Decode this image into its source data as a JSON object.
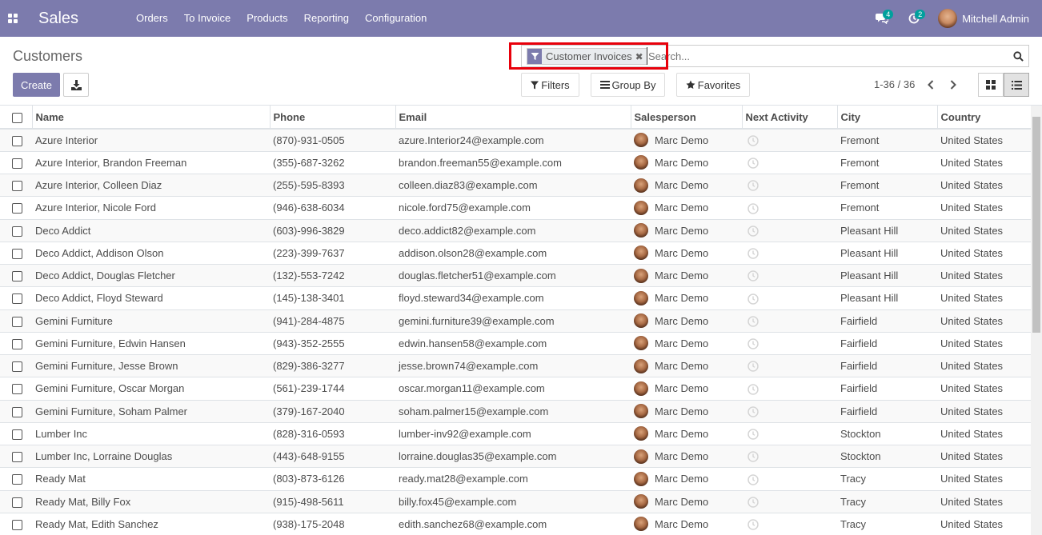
{
  "navbar": {
    "brand": "Sales",
    "menu": [
      "Orders",
      "To Invoice",
      "Products",
      "Reporting",
      "Configuration"
    ],
    "messages_count": "4",
    "activities_count": "2",
    "user_name": "Mitchell Admin"
  },
  "control_panel": {
    "title": "Customers",
    "facet_label": "Customer Invoices",
    "search_placeholder": "Search...",
    "create_label": "Create",
    "filters_label": "Filters",
    "groupby_label": "Group By",
    "favorites_label": "Favorites",
    "pager": "1-36 / 36"
  },
  "table": {
    "columns": [
      "Name",
      "Phone",
      "Email",
      "Salesperson",
      "Next Activity",
      "City",
      "Country"
    ],
    "rows": [
      {
        "name": "Azure Interior",
        "phone": "(870)-931-0505",
        "email": "azure.Interior24@example.com",
        "salesperson": "Marc Demo",
        "city": "Fremont",
        "country": "United States"
      },
      {
        "name": "Azure Interior, Brandon Freeman",
        "phone": "(355)-687-3262",
        "email": "brandon.freeman55@example.com",
        "salesperson": "Marc Demo",
        "city": "Fremont",
        "country": "United States"
      },
      {
        "name": "Azure Interior, Colleen Diaz",
        "phone": "(255)-595-8393",
        "email": "colleen.diaz83@example.com",
        "salesperson": "Marc Demo",
        "city": "Fremont",
        "country": "United States"
      },
      {
        "name": "Azure Interior, Nicole Ford",
        "phone": "(946)-638-6034",
        "email": "nicole.ford75@example.com",
        "salesperson": "Marc Demo",
        "city": "Fremont",
        "country": "United States"
      },
      {
        "name": "Deco Addict",
        "phone": "(603)-996-3829",
        "email": "deco.addict82@example.com",
        "salesperson": "Marc Demo",
        "city": "Pleasant Hill",
        "country": "United States"
      },
      {
        "name": "Deco Addict, Addison Olson",
        "phone": "(223)-399-7637",
        "email": "addison.olson28@example.com",
        "salesperson": "Marc Demo",
        "city": "Pleasant Hill",
        "country": "United States"
      },
      {
        "name": "Deco Addict, Douglas Fletcher",
        "phone": "(132)-553-7242",
        "email": "douglas.fletcher51@example.com",
        "salesperson": "Marc Demo",
        "city": "Pleasant Hill",
        "country": "United States"
      },
      {
        "name": "Deco Addict, Floyd Steward",
        "phone": "(145)-138-3401",
        "email": "floyd.steward34@example.com",
        "salesperson": "Marc Demo",
        "city": "Pleasant Hill",
        "country": "United States"
      },
      {
        "name": "Gemini Furniture",
        "phone": "(941)-284-4875",
        "email": "gemini.furniture39@example.com",
        "salesperson": "Marc Demo",
        "city": "Fairfield",
        "country": "United States"
      },
      {
        "name": "Gemini Furniture, Edwin Hansen",
        "phone": "(943)-352-2555",
        "email": "edwin.hansen58@example.com",
        "salesperson": "Marc Demo",
        "city": "Fairfield",
        "country": "United States"
      },
      {
        "name": "Gemini Furniture, Jesse Brown",
        "phone": "(829)-386-3277",
        "email": "jesse.brown74@example.com",
        "salesperson": "Marc Demo",
        "city": "Fairfield",
        "country": "United States"
      },
      {
        "name": "Gemini Furniture, Oscar Morgan",
        "phone": "(561)-239-1744",
        "email": "oscar.morgan11@example.com",
        "salesperson": "Marc Demo",
        "city": "Fairfield",
        "country": "United States"
      },
      {
        "name": "Gemini Furniture, Soham Palmer",
        "phone": "(379)-167-2040",
        "email": "soham.palmer15@example.com",
        "salesperson": "Marc Demo",
        "city": "Fairfield",
        "country": "United States"
      },
      {
        "name": "Lumber Inc",
        "phone": "(828)-316-0593",
        "email": "lumber-inv92@example.com",
        "salesperson": "Marc Demo",
        "city": "Stockton",
        "country": "United States"
      },
      {
        "name": "Lumber Inc, Lorraine Douglas",
        "phone": "(443)-648-9155",
        "email": "lorraine.douglas35@example.com",
        "salesperson": "Marc Demo",
        "city": "Stockton",
        "country": "United States"
      },
      {
        "name": "Ready Mat",
        "phone": "(803)-873-6126",
        "email": "ready.mat28@example.com",
        "salesperson": "Marc Demo",
        "city": "Tracy",
        "country": "United States"
      },
      {
        "name": "Ready Mat, Billy Fox",
        "phone": "(915)-498-5611",
        "email": "billy.fox45@example.com",
        "salesperson": "Marc Demo",
        "city": "Tracy",
        "country": "United States"
      },
      {
        "name": "Ready Mat, Edith Sanchez",
        "phone": "(938)-175-2048",
        "email": "edith.sanchez68@example.com",
        "salesperson": "Marc Demo",
        "city": "Tracy",
        "country": "United States"
      }
    ]
  },
  "colors": {
    "primary": "#7c7bad",
    "highlight": "#e8000b",
    "badge": "#00a09d"
  }
}
